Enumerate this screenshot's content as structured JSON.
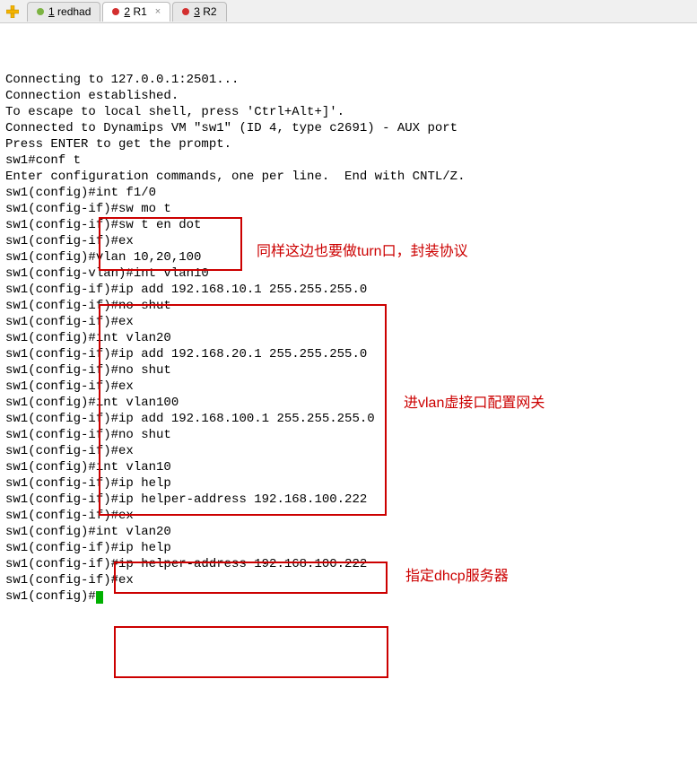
{
  "tabs": {
    "items": [
      {
        "num": "1",
        "label": "redhad",
        "dot": "#7cb342"
      },
      {
        "num": "2",
        "label": "R1",
        "dot": "#d32f2f",
        "active": true
      },
      {
        "num": "3",
        "label": "R2",
        "dot": "#d32f2f"
      }
    ]
  },
  "terminal": {
    "lines": [
      "",
      "Connecting to 127.0.0.1:2501...",
      "Connection established.",
      "To escape to local shell, press 'Ctrl+Alt+]'.",
      "Connected to Dynamips VM \"sw1\" (ID 4, type c2691) - AUX port",
      "Press ENTER to get the prompt.",
      "",
      "sw1#conf t",
      "Enter configuration commands, one per line.  End with CNTL/Z.",
      "sw1(config)#int f1/0",
      "sw1(config-if)#sw mo t",
      "sw1(config-if)#sw t en dot",
      "sw1(config-if)#ex",
      "sw1(config)#vlan 10,20,100",
      "sw1(config-vlan)#int vlan10",
      "sw1(config-if)#ip add 192.168.10.1 255.255.255.0",
      "sw1(config-if)#no shut",
      "sw1(config-if)#ex",
      "sw1(config)#int vlan20",
      "sw1(config-if)#ip add 192.168.20.1 255.255.255.0",
      "sw1(config-if)#no shut",
      "sw1(config-if)#ex",
      "sw1(config)#int vlan100",
      "sw1(config-if)#ip add 192.168.100.1 255.255.255.0",
      "sw1(config-if)#no shut",
      "sw1(config-if)#ex",
      "sw1(config)#int vlan10",
      "sw1(config-if)#ip help",
      "sw1(config-if)#ip helper-address 192.168.100.222",
      "sw1(config-if)#ex",
      "sw1(config)#int vlan20",
      "sw1(config-if)#ip help",
      "sw1(config-if)#ip helper-address 192.168.100.222",
      "sw1(config-if)#ex",
      "sw1(config)#"
    ]
  },
  "annotations": {
    "a1": "同样这边也要做turn口，封装协议",
    "a2": "进vlan虚接口配置网关",
    "a3": "指定dhcp服务器"
  }
}
